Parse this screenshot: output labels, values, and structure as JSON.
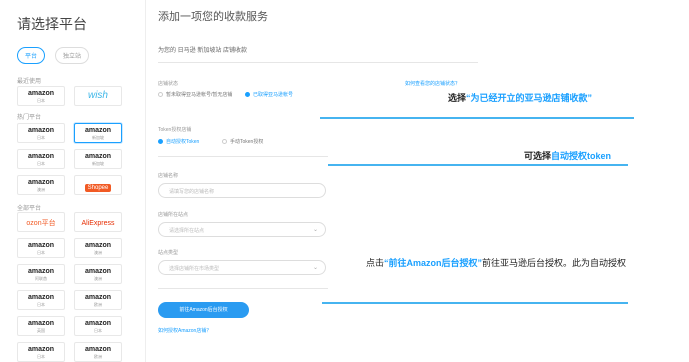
{
  "sidebar": {
    "title": "请选择平台",
    "tabs": [
      "平台",
      "独立站"
    ],
    "sections": {
      "recent": "最近使用",
      "hot": "热门平台",
      "all": "全部平台"
    },
    "recent_cards": [
      {
        "logo": "amazon",
        "sub": "日本"
      },
      {
        "logo": "wish",
        "sub": ""
      }
    ],
    "hot_cards": [
      {
        "logo": "amazon",
        "sub": "日本"
      },
      {
        "logo": "amazon",
        "sub": "新加坡"
      },
      {
        "logo": "amazon",
        "sub": "日本"
      },
      {
        "logo": "amazon",
        "sub": "新加坡"
      },
      {
        "logo": "amazon",
        "sub": "澳洲"
      },
      {
        "logo": "Shopee",
        "sub": ""
      }
    ],
    "all_cards": [
      {
        "logo": "ozon平台",
        "sub": ""
      },
      {
        "logo": "AliExpress",
        "sub": ""
      },
      {
        "logo": "amazon",
        "sub": "日本"
      },
      {
        "logo": "amazon",
        "sub": "澳洲"
      },
      {
        "logo": "amazon",
        "sub": "阿联酋"
      },
      {
        "logo": "amazon",
        "sub": "澳洲"
      },
      {
        "logo": "amazon",
        "sub": "日本"
      },
      {
        "logo": "amazon",
        "sub": "欧洲"
      },
      {
        "logo": "amazon",
        "sub": "英国"
      },
      {
        "logo": "amazon",
        "sub": "日本"
      },
      {
        "logo": "amazon",
        "sub": "日本"
      },
      {
        "logo": "amazon",
        "sub": "欧洲"
      }
    ]
  },
  "main": {
    "title": "添加一项您的收款服务",
    "subtitle": "为您的 日马逊 新加坡站 店铺收款",
    "store_status_label": "店铺状态",
    "store_status_options": [
      "暂未取得亚马逊帐号/暂无店铺",
      "已取得亚马逊帐号"
    ],
    "store_status_link": "如何查看您的店铺状态？",
    "token_label": "Token授权店铺",
    "token_options": [
      "自动授权Token",
      "手动Token授权"
    ],
    "store_name_label": "店铺名称",
    "store_name_placeholder": "请填写您的店铺名称",
    "site_label": "店铺所在站点",
    "site_placeholder": "请选择所在站点",
    "market_label": "站点类型",
    "market_placeholder": "选择店铺所在市场类型",
    "authorize_button": "前往Amazon后台授权",
    "help_link": "如何授权Amazon店铺？"
  },
  "annotations": {
    "note1_prefix": "选择",
    "note1_highlight": "“为已经开立的亚马逊店铺收款”",
    "note2_prefix": "可选择",
    "note2_highlight": "自动授权token",
    "note3_prefix": "点击",
    "note3_highlight": "“前往Amazon后台授权”",
    "note3_suffix": "前往亚马逊后台授权。此为自动授权"
  }
}
